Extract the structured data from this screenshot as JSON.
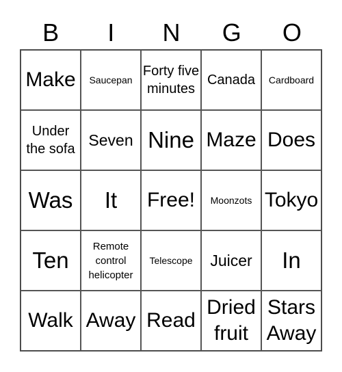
{
  "header": [
    "B",
    "I",
    "N",
    "G",
    "O"
  ],
  "cells": [
    {
      "text": "Make",
      "size": "s-l"
    },
    {
      "text": "Saucepan",
      "size": "s-t"
    },
    {
      "text": "Forty five minutes",
      "size": "s-n"
    },
    {
      "text": "Canada",
      "size": "s-n"
    },
    {
      "text": "Cardboard",
      "size": "s-t"
    },
    {
      "text": "Under the sofa",
      "size": "s-n"
    },
    {
      "text": "Seven",
      "size": "s-m"
    },
    {
      "text": "Nine",
      "size": "s-xl"
    },
    {
      "text": "Maze",
      "size": "s-l"
    },
    {
      "text": "Does",
      "size": "s-l"
    },
    {
      "text": "Was",
      "size": "s-xl"
    },
    {
      "text": "It",
      "size": "s-xl"
    },
    {
      "text": "Free!",
      "size": "s-l"
    },
    {
      "text": "Moonzots",
      "size": "s-t"
    },
    {
      "text": "Tokyo",
      "size": "s-l"
    },
    {
      "text": "Ten",
      "size": "s-xl"
    },
    {
      "text": "Remote control helicopter",
      "size": "s-xs"
    },
    {
      "text": "Telescope",
      "size": "s-t"
    },
    {
      "text": "Juicer",
      "size": "s-m"
    },
    {
      "text": "In",
      "size": "s-xl"
    },
    {
      "text": "Walk",
      "size": "s-l"
    },
    {
      "text": "Away",
      "size": "s-l"
    },
    {
      "text": "Read",
      "size": "s-l"
    },
    {
      "text": "Dried fruit",
      "size": "s-l"
    },
    {
      "text": "Stars Away",
      "size": "s-l"
    }
  ]
}
